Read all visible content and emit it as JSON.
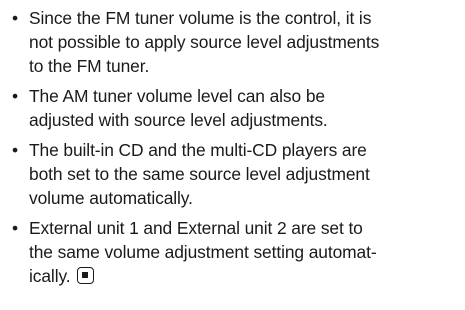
{
  "notes": {
    "bullet_symbol": "•",
    "items": [
      {
        "lines": [
          "Since the FM tuner volume is the control, it is",
          "not possible to apply source level adjustments",
          "to the FM tuner."
        ]
      },
      {
        "lines": [
          "The AM tuner volume level can also be",
          "adjusted with source level adjustments."
        ]
      },
      {
        "lines": [
          "The built-in CD and the multi-CD players are",
          "both set to the same source level adjustment",
          "volume automatically."
        ]
      },
      {
        "lines": [
          "External unit 1 and External unit 2 are set to",
          "the same volume adjustment setting automat-",
          "ically."
        ]
      }
    ],
    "end_mark_icon": "stop-square-icon"
  }
}
